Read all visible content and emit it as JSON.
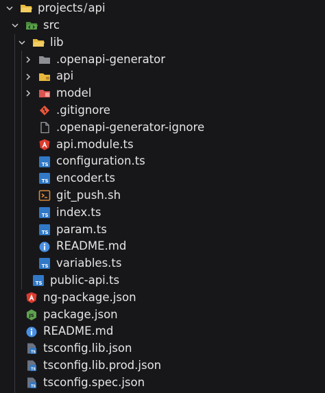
{
  "root": {
    "part1": "projects",
    "sep": "/",
    "part2": "api"
  },
  "colors": {
    "background": "#17171a",
    "folder_yellow": "#e8b93d",
    "folder_grey": "#8d8f95",
    "folder_green": "#5aa34a",
    "folder_red": "#d9534f",
    "ts_blue": "#3178c6",
    "angular_red": "#dd3b2e",
    "node_green": "#5fa04e",
    "shell_orange": "#d58a3c",
    "info_blue": "#4a90e2",
    "git_orange": "#e8553a",
    "file_grey": "#9a9aa0"
  },
  "items": [
    {
      "label": "projects/api",
      "icon": "folder-open-icon",
      "state": "expanded"
    },
    {
      "label": "src",
      "icon": "src-folder-open-icon",
      "state": "expanded"
    },
    {
      "label": "lib",
      "icon": "folder-open-icon",
      "state": "expanded"
    },
    {
      "label": ".openapi-generator",
      "icon": "folder-grey-icon",
      "state": "collapsed"
    },
    {
      "label": "api",
      "icon": "folder-yellow-icon",
      "state": "collapsed"
    },
    {
      "label": "model",
      "icon": "folder-red-icon",
      "state": "collapsed"
    },
    {
      "label": ".gitignore",
      "icon": "git-icon"
    },
    {
      "label": ".openapi-generator-ignore",
      "icon": "file-icon"
    },
    {
      "label": "api.module.ts",
      "icon": "angular-icon"
    },
    {
      "label": "configuration.ts",
      "icon": "typescript-icon"
    },
    {
      "label": "encoder.ts",
      "icon": "typescript-icon"
    },
    {
      "label": "git_push.sh",
      "icon": "shell-icon"
    },
    {
      "label": "index.ts",
      "icon": "typescript-icon"
    },
    {
      "label": "param.ts",
      "icon": "typescript-icon"
    },
    {
      "label": "README.md",
      "icon": "info-icon"
    },
    {
      "label": "variables.ts",
      "icon": "typescript-icon"
    },
    {
      "label": "public-api.ts",
      "icon": "typescript-icon"
    },
    {
      "label": "ng-package.json",
      "icon": "angular-icon"
    },
    {
      "label": "package.json",
      "icon": "nodejs-icon"
    },
    {
      "label": "README.md",
      "icon": "info-icon"
    },
    {
      "label": "tsconfig.lib.json",
      "icon": "tsconfig-icon"
    },
    {
      "label": "tsconfig.lib.prod.json",
      "icon": "tsconfig-icon"
    },
    {
      "label": "tsconfig.spec.json",
      "icon": "tsconfig-icon"
    }
  ]
}
